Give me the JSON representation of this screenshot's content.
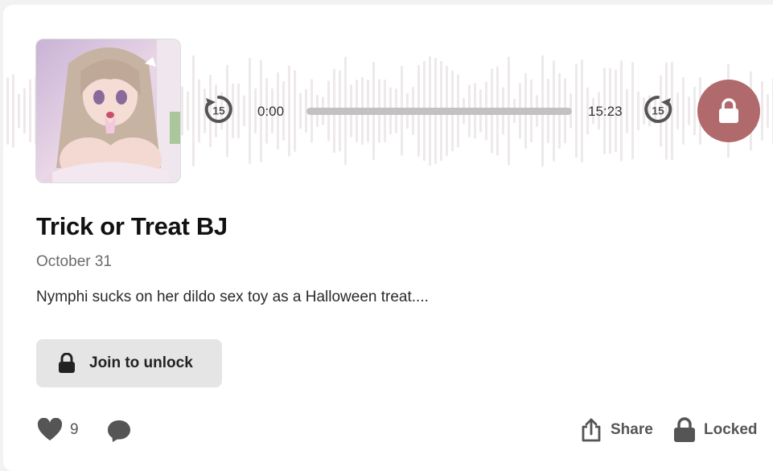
{
  "player": {
    "cover_icon": "anime-girl-cover-art",
    "skip_back_label": "15",
    "skip_forward_label": "15",
    "current_time": "0:00",
    "total_time": "15:23",
    "progress_fraction": 0,
    "lock_color": "#b06a6c"
  },
  "post": {
    "title": "Trick or Treat BJ",
    "date": "October 31",
    "description": "Nymphi sucks on her dildo sex toy as a Halloween treat...."
  },
  "unlock_button": {
    "label": "Join to unlock",
    "icon": "lock-icon"
  },
  "footer": {
    "like_icon": "heart-icon",
    "like_count": "9",
    "comment_icon": "comment-icon",
    "share_icon": "share-icon",
    "share_label": "Share",
    "locked_icon": "lock-icon",
    "locked_label": "Locked"
  }
}
